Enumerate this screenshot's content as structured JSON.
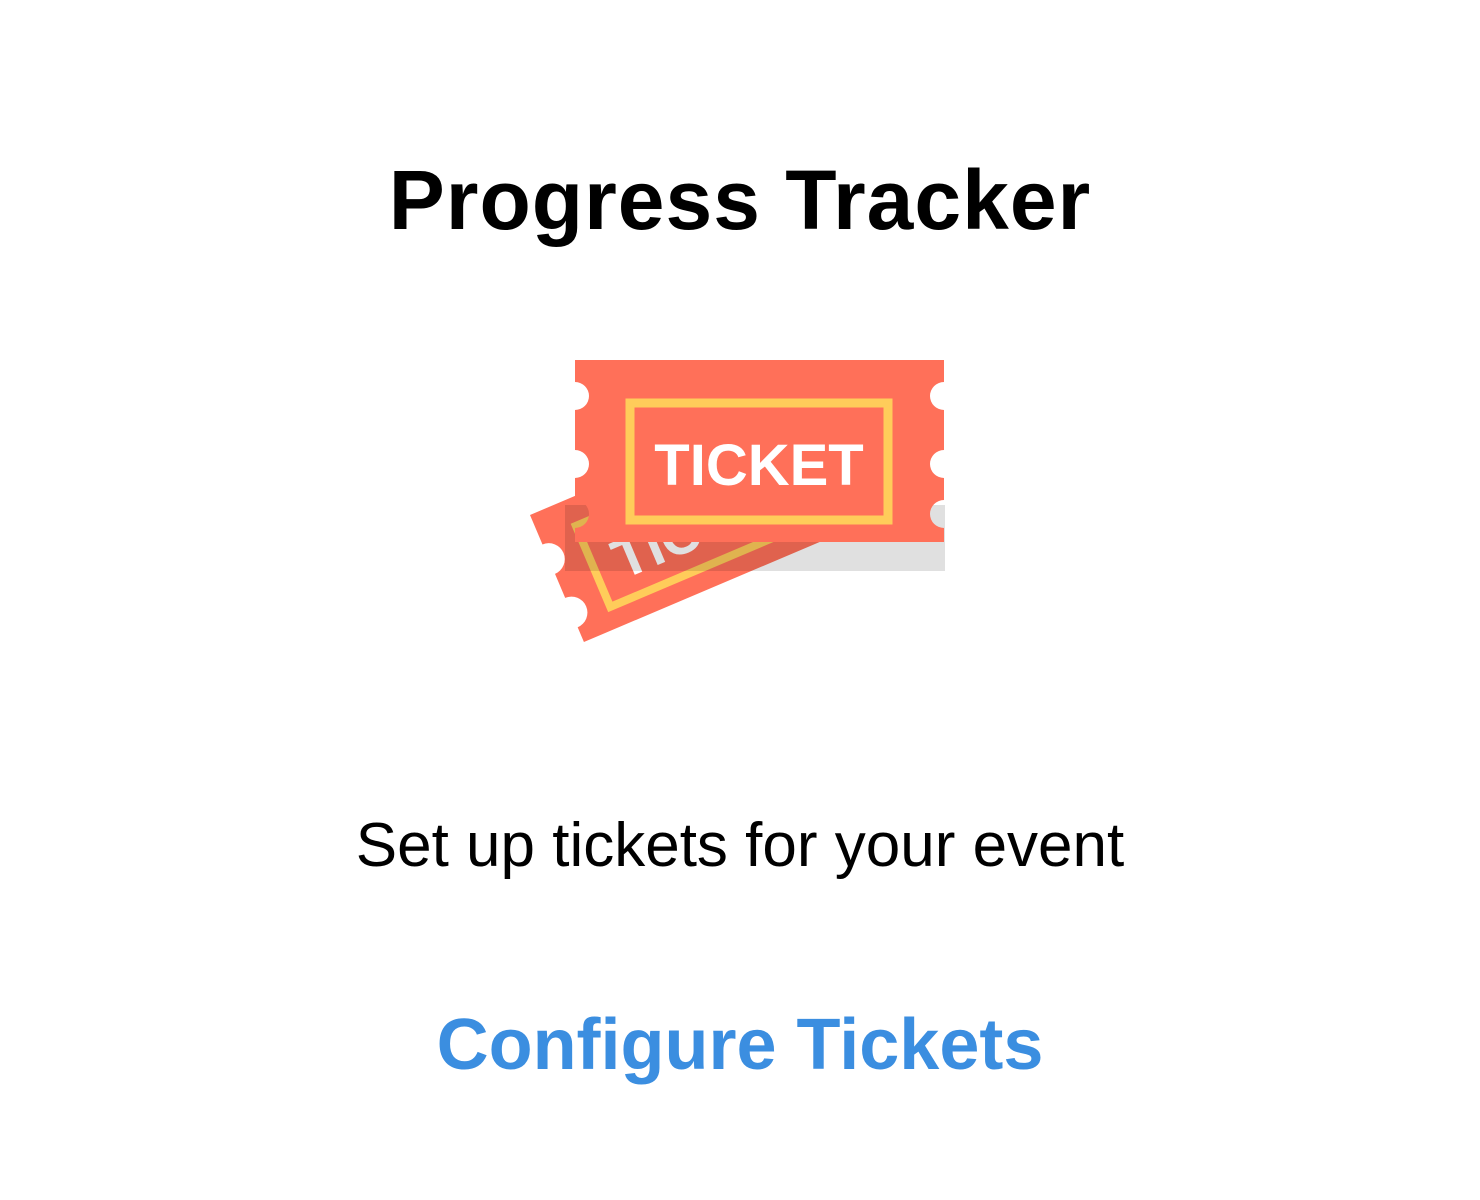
{
  "header": {
    "title": "Progress Tracker"
  },
  "illustration": {
    "icon": "tickets-icon",
    "front_ticket_text": "TICKET",
    "back_ticket_text": "TIC",
    "colors": {
      "ticket": "#FF7059",
      "border": "#FFCC5A",
      "text": "#FFFFFF"
    }
  },
  "main": {
    "message": "Set up tickets for your event",
    "action_label": "Configure Tickets",
    "action_color": "#3B8EE0"
  }
}
